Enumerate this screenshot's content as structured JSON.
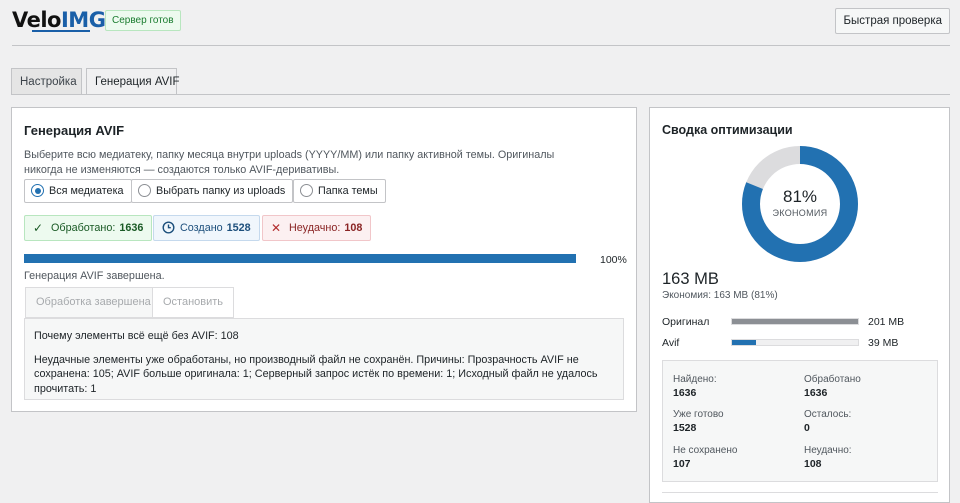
{
  "header": {
    "logo_text_a": "Velo",
    "logo_text_b": "IMG",
    "server_status": "Сервер готов",
    "quick_check": "Быстрая проверка"
  },
  "tabs": [
    {
      "label": "Настройка",
      "active": false
    },
    {
      "label": "Генерация AVIF",
      "active": true
    }
  ],
  "main": {
    "title": "Генерация AVIF",
    "description": "Выберите всю медиатеку, папку месяца внутри uploads (YYYY/MM) или папку активной темы. Оригиналы никогда не изменяются — создаются только AVIF-деривативы.",
    "scope_options": [
      {
        "label": "Вся медиатека",
        "selected": true
      },
      {
        "label": "Выбрать папку из uploads",
        "selected": false
      },
      {
        "label": "Папка темы",
        "selected": false
      }
    ],
    "stats": {
      "processed_label": "Обработано:",
      "processed_value": "1636",
      "processed_icon": "check-icon",
      "created_label": "Создано",
      "created_value": "1528",
      "created_icon": "clock-icon",
      "failed_label": "Неудачно:",
      "failed_value": "108",
      "failed_icon": "x-icon"
    },
    "progress_percent": 100,
    "progress_label": "100%",
    "status_text": "Генерация AVIF завершена.",
    "done_button": "Обработка завершена",
    "stop_button": "Остановить",
    "info_question": "Почему элементы всё ещё без AVIF: 108",
    "info_details": "Неудачные элементы уже обработаны, но производный файл не сохранён. Причины: Прозрачность AVIF не сохранена: 105; AVIF больше оригинала: 1; Серверный запрос истёк по времени: 1; Исходный файл не удалось прочитать: 1"
  },
  "summary": {
    "title": "Сводка оптимизации",
    "percent": 81,
    "percent_label": "81%",
    "percent_caption": "ЭКОНОМИЯ",
    "saved_size": "163 MB",
    "saved_text": "Экономия: 163 MB (81%)",
    "bars": [
      {
        "label": "Оригинал",
        "value": "201 MB",
        "fraction": 1.0,
        "color": "#8c8f94"
      },
      {
        "label": "Avif",
        "value": "39 MB",
        "fraction": 0.19,
        "color": "#2271b1"
      }
    ],
    "cells": [
      {
        "label": "Найдено:",
        "value": "1636"
      },
      {
        "label": "Обработано",
        "value": "1636"
      },
      {
        "label": "Уже готово",
        "value": "1528"
      },
      {
        "label": "Осталось:",
        "value": "0"
      },
      {
        "label": "Не сохранено",
        "value": "107"
      },
      {
        "label": "Неудачно:",
        "value": "108"
      }
    ],
    "colors": {
      "donut_fill": "#2271b1",
      "donut_track": "#dcdcde"
    }
  }
}
